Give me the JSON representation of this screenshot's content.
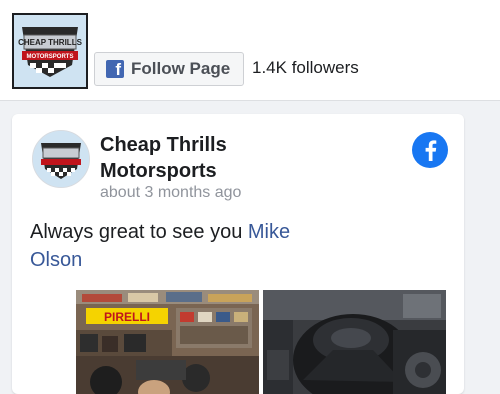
{
  "header": {
    "follow_label": "Follow Page",
    "followers": "1.4K followers"
  },
  "logo": {
    "text_top": "CHEAP THRILLS",
    "text_band": "MOTORSPORTS"
  },
  "post": {
    "page_name": "Cheap Thrills Motorsports",
    "time": "about 3 months ago",
    "text": "Always great to see you ",
    "mention": "Mike Olson",
    "photo1_sign": "PIRELLI"
  },
  "colors": {
    "facebook_blue": "#1877f2",
    "link_blue": "#385898",
    "pirelli_yellow": "#f5d300"
  }
}
